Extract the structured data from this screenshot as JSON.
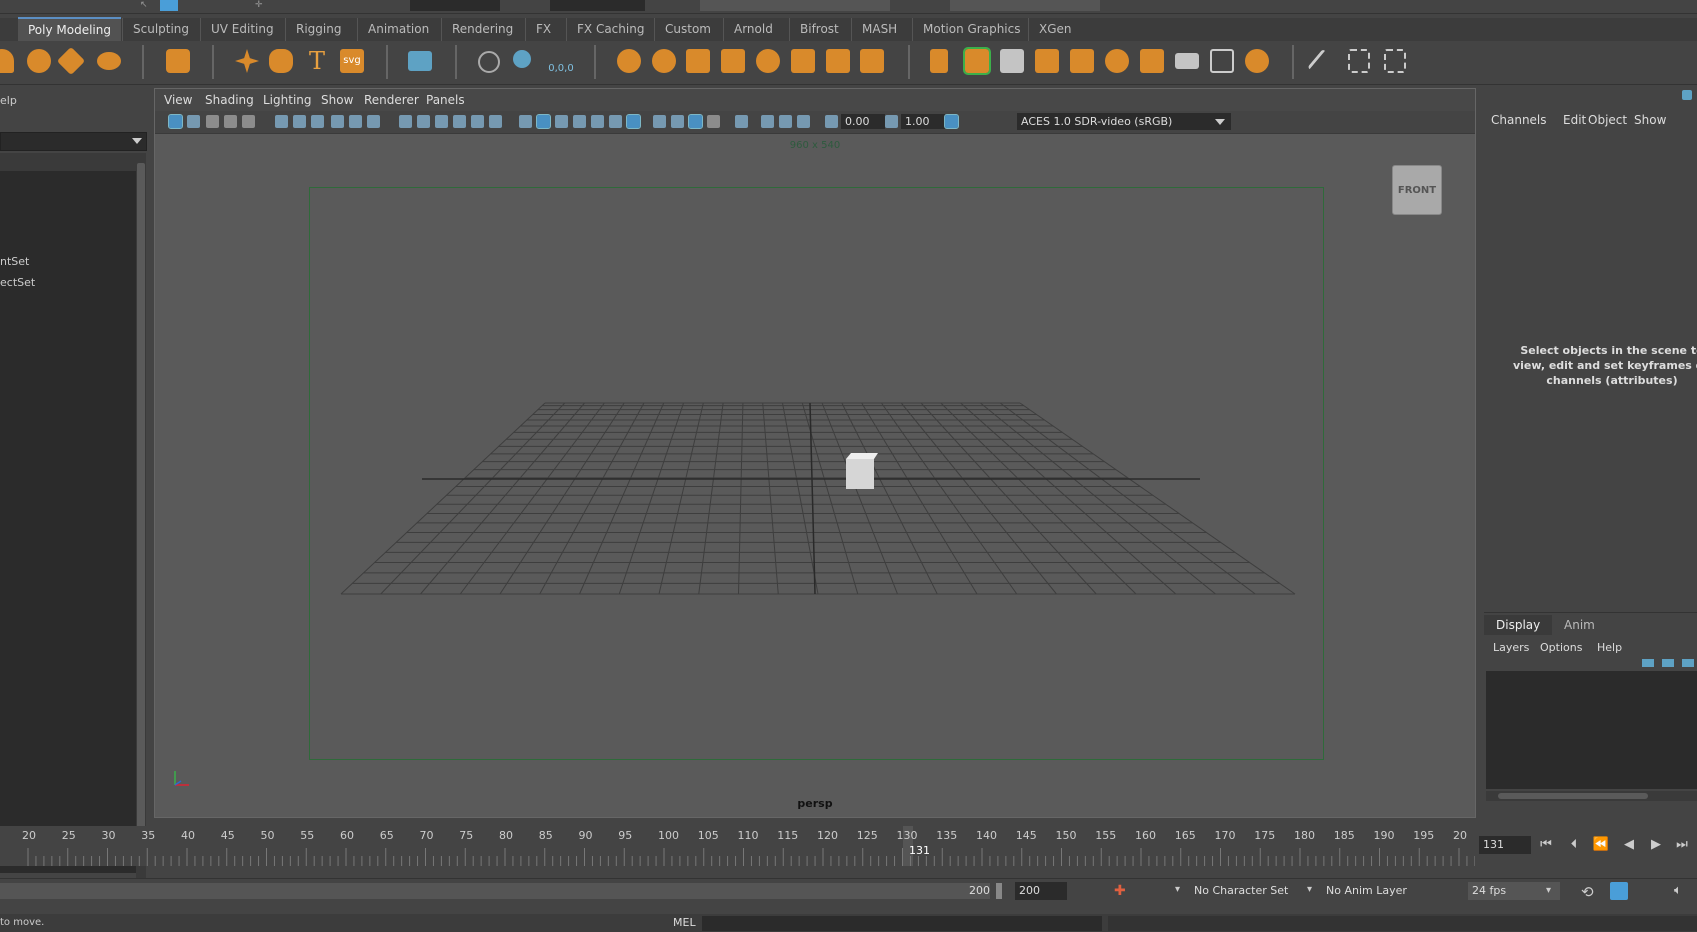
{
  "shelf": {
    "tabs": [
      {
        "label": "Poly Modeling",
        "active": true
      },
      {
        "label": "Sculpting"
      },
      {
        "label": "UV Editing"
      },
      {
        "label": "Rigging"
      },
      {
        "label": "Animation"
      },
      {
        "label": "Rendering"
      },
      {
        "label": "FX"
      },
      {
        "label": "FX Caching"
      },
      {
        "label": "Custom"
      },
      {
        "label": "Arnold"
      },
      {
        "label": "Bifrost"
      },
      {
        "label": "MASH"
      },
      {
        "label": "Motion Graphics"
      },
      {
        "label": "XGen"
      }
    ],
    "text_tool_glyph": "T",
    "svg_tool_label": "svg",
    "coord_label": "0,0,0"
  },
  "left_panel": {
    "menu_fragment": "elp",
    "items": [
      "ntSet",
      "ectSet"
    ]
  },
  "viewport": {
    "menus": [
      "View",
      "Shading",
      "Lighting",
      "Show",
      "Renderer",
      "Panels"
    ],
    "exposure": "0.00",
    "gamma": "1.00",
    "color_space": "ACES 1.0 SDR-video (sRGB)",
    "resolution": "960 x 540",
    "view_cube_label": "FRONT",
    "camera_name": "persp"
  },
  "channel_box": {
    "menus": [
      "Channels",
      "Edit",
      "Object",
      "Show"
    ],
    "hint": "Select objects in the scene to view, edit and set keyframes on channels (attributes)"
  },
  "layer_editor": {
    "tabs": [
      "Display",
      "Anim"
    ],
    "active_tab": "Display",
    "menus": [
      "Layers",
      "Options",
      "Help"
    ]
  },
  "timeline": {
    "ticks": [
      "20",
      "25",
      "30",
      "35",
      "40",
      "45",
      "50",
      "55",
      "60",
      "65",
      "70",
      "75",
      "80",
      "85",
      "90",
      "95",
      "100",
      "105",
      "110",
      "115",
      "120",
      "125",
      "130",
      "135",
      "140",
      "145",
      "150",
      "155",
      "160",
      "165",
      "170",
      "175",
      "180",
      "185",
      "190",
      "195",
      "20"
    ],
    "current_frame": "131",
    "current_frame_box": "131"
  },
  "range": {
    "end_value": "200",
    "end_box": "200",
    "character_set": "No Character Set",
    "anim_layer": "No Anim Layer",
    "fps": "24 fps"
  },
  "command_line": {
    "status": "to move.",
    "language": "MEL"
  },
  "colors": {
    "accent": "#d98a2b",
    "select_blue": "#4a9ed8",
    "gate_green": "#2f6a3a"
  }
}
